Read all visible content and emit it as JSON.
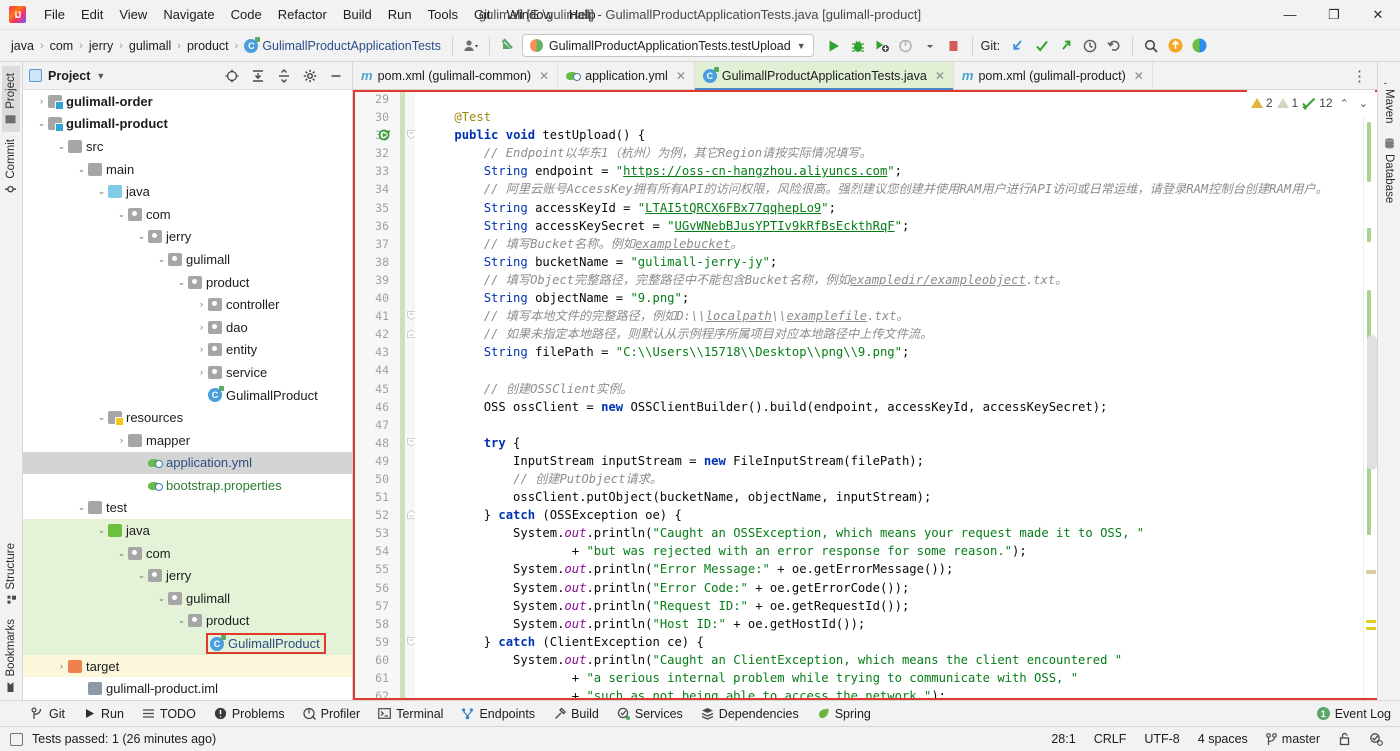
{
  "window": {
    "title": "gulimall [E:\\gulimall] - GulimallProductApplicationTests.java [gulimall-product]",
    "minimize": "—",
    "maximize": "❐",
    "close": "✕"
  },
  "menu": [
    "File",
    "Edit",
    "View",
    "Navigate",
    "Code",
    "Refactor",
    "Build",
    "Run",
    "Tools",
    "Git",
    "Window",
    "Help"
  ],
  "navbar": {
    "breadcrumbs": [
      "java",
      "com",
      "jerry",
      "gulimall",
      "product",
      "GulimallProductApplicationTests"
    ],
    "separator": "›",
    "run_config": "GulimallProductApplicationTests.testUpload",
    "dropdown_caret": "▼",
    "git_label": "Git:",
    "icons": [
      "profile-icon",
      "update-project-icon",
      "run-icon",
      "debug-icon",
      "run-coverage-icon",
      "profiler-icon",
      "stop-icon",
      "git-update-icon",
      "git-commit-icon",
      "git-push-icon",
      "history-icon",
      "rollback-icon",
      "search-everywhere-icon",
      "notifications-icon",
      "ai-assistant-icon"
    ]
  },
  "left_stripe": [
    {
      "label": "Project",
      "icon": "project-icon",
      "selected": true
    },
    {
      "label": "Commit",
      "icon": "commit-icon",
      "selected": false
    },
    {
      "label": "Structure",
      "icon": "structure-icon",
      "selected": false
    },
    {
      "label": "Bookmarks",
      "icon": "bookmarks-icon",
      "selected": false
    }
  ],
  "right_stripe": [
    {
      "label": "Maven",
      "icon": "maven-icon"
    },
    {
      "label": "Database",
      "icon": "database-icon"
    }
  ],
  "project_panel": {
    "title": "Project",
    "title_caret": "▼",
    "toolbar_icons": [
      "select-opened-file-icon",
      "expand-all-icon",
      "collapse-all-icon",
      "settings-gear-icon",
      "hide-icon"
    ],
    "tree": [
      {
        "label": "gulimall-order",
        "indent": 1,
        "arrow": "›",
        "icon": "module-folder-icon",
        "bold": true,
        "bg": "none"
      },
      {
        "label": "gulimall-product",
        "indent": 1,
        "arrow": "⌄",
        "icon": "module-folder-icon",
        "bold": true,
        "bg": "none"
      },
      {
        "label": "src",
        "indent": 2,
        "arrow": "⌄",
        "icon": "folder-icon",
        "bold": false,
        "bg": "none"
      },
      {
        "label": "main",
        "indent": 3,
        "arrow": "⌄",
        "icon": "folder-icon",
        "bold": false,
        "bg": "none"
      },
      {
        "label": "java",
        "indent": 4,
        "arrow": "⌄",
        "icon": "source-root-icon",
        "bold": false,
        "bg": "none"
      },
      {
        "label": "com",
        "indent": 5,
        "arrow": "⌄",
        "icon": "package-icon",
        "bold": false,
        "bg": "none"
      },
      {
        "label": "jerry",
        "indent": 6,
        "arrow": "⌄",
        "icon": "package-icon",
        "bold": false,
        "bg": "none"
      },
      {
        "label": "gulimall",
        "indent": 7,
        "arrow": "⌄",
        "icon": "package-icon",
        "bold": false,
        "bg": "none"
      },
      {
        "label": "product",
        "indent": 8,
        "arrow": "⌄",
        "icon": "package-icon",
        "bold": false,
        "bg": "none"
      },
      {
        "label": "controller",
        "indent": 9,
        "arrow": "›",
        "icon": "package-icon",
        "bold": false,
        "bg": "none"
      },
      {
        "label": "dao",
        "indent": 9,
        "arrow": "›",
        "icon": "package-icon",
        "bold": false,
        "bg": "none"
      },
      {
        "label": "entity",
        "indent": 9,
        "arrow": "›",
        "icon": "package-icon",
        "bold": false,
        "bg": "none"
      },
      {
        "label": "service",
        "indent": 9,
        "arrow": "›",
        "icon": "package-icon",
        "bold": false,
        "bg": "none"
      },
      {
        "label": "GulimallProduct",
        "indent": 9,
        "arrow": "",
        "icon": "java-class-icon",
        "bold": false,
        "bg": "none"
      },
      {
        "label": "resources",
        "indent": 4,
        "arrow": "⌄",
        "icon": "resources-folder-icon",
        "bold": false,
        "bg": "none"
      },
      {
        "label": "mapper",
        "indent": 5,
        "arrow": "›",
        "icon": "folder-icon",
        "bold": false,
        "bg": "none"
      },
      {
        "label": "application.yml",
        "indent": 6,
        "arrow": "",
        "icon": "yaml-file-icon",
        "bold": false,
        "bg": "selected",
        "color": "blue"
      },
      {
        "label": "bootstrap.properties",
        "indent": 6,
        "arrow": "",
        "icon": "yaml-file-icon",
        "bold": false,
        "bg": "none",
        "color": "green"
      },
      {
        "label": "test",
        "indent": 3,
        "arrow": "⌄",
        "icon": "folder-icon",
        "bold": false,
        "bg": "none"
      },
      {
        "label": "java",
        "indent": 4,
        "arrow": "⌄",
        "icon": "test-source-root-icon",
        "bold": false,
        "bg": "green"
      },
      {
        "label": "com",
        "indent": 5,
        "arrow": "⌄",
        "icon": "package-icon",
        "bold": false,
        "bg": "green"
      },
      {
        "label": "jerry",
        "indent": 6,
        "arrow": "⌄",
        "icon": "package-icon",
        "bold": false,
        "bg": "green"
      },
      {
        "label": "gulimall",
        "indent": 7,
        "arrow": "⌄",
        "icon": "package-icon",
        "bold": false,
        "bg": "green"
      },
      {
        "label": "product",
        "indent": 8,
        "arrow": "⌄",
        "icon": "package-icon",
        "bold": false,
        "bg": "green"
      },
      {
        "label": "GulimallProduct",
        "indent": 9,
        "arrow": "",
        "icon": "java-class-icon",
        "bold": false,
        "bg": "green",
        "color": "blue",
        "highlight": true
      },
      {
        "label": "target",
        "indent": 2,
        "arrow": "›",
        "icon": "excluded-folder-icon",
        "bold": false,
        "bg": "yellow"
      },
      {
        "label": "gulimall-product.iml",
        "indent": 3,
        "arrow": "",
        "icon": "iml-file-icon",
        "bold": false,
        "bg": "none"
      }
    ]
  },
  "editor": {
    "tabs": [
      {
        "label": "pom.xml (gulimall-common)",
        "icon": "maven-xml-icon",
        "active": false,
        "close": "✕"
      },
      {
        "label": "application.yml",
        "icon": "yaml-file-icon",
        "active": false,
        "close": "✕"
      },
      {
        "label": "GulimallProductApplicationTests.java",
        "icon": "java-class-icon",
        "active": true,
        "close": "✕"
      },
      {
        "label": "pom.xml (gulimall-product)",
        "icon": "maven-xml-icon",
        "active": false,
        "close": "✕"
      }
    ],
    "overflow_icon": "⋮",
    "first_line_number": 29,
    "last_line_number": 62,
    "inspection": {
      "warnings": "2",
      "weak_warnings": "1",
      "checks": "12",
      "up_caret": "⌃",
      "down_caret": "⌄"
    },
    "lines": [
      {
        "n": 29,
        "html": ""
      },
      {
        "n": 30,
        "html": "    <span class='ann'>@Test</span>"
      },
      {
        "n": 31,
        "html": "    <span class='kw'>public</span> <span class='kw'>void</span> testUpload() {",
        "run": true
      },
      {
        "n": 32,
        "html": "        <span class='cmt'>// Endpoint以华东1（杭州）为例，其它Region请按实际情况填写。</span>"
      },
      {
        "n": 33,
        "html": "        <span class='kw2'>String</span> endpoint = <span class='str'>\"</span><span class='lnk'>https://oss-cn-hangzhou.aliyuncs.com</span><span class='str'>\"</span>;"
      },
      {
        "n": 34,
        "html": "        <span class='cmt'>// 阿里云账号AccessKey拥有所有API的访问权限，风险很高。强烈建议您创建并使用RAM用户进行API访问或日常运维，请登录RAM控制台创建RAM用户。</span>"
      },
      {
        "n": 35,
        "html": "        <span class='kw2'>String</span> accessKeyId = <span class='str'>\"</span><span class='str ul'>LTAI5tQRCX6FBx77qqhepLo9</span><span class='str'>\"</span>;"
      },
      {
        "n": 36,
        "html": "        <span class='kw2'>String</span> accessKeySecret = <span class='str'>\"</span><span class='str ul'>UGvWNebBJusYPTIv9kRfBsEckthRqF</span><span class='str'>\"</span>;"
      },
      {
        "n": 37,
        "html": "        <span class='cmt'>// 填写Bucket名称。例如<span class='ul'>examplebucket</span>。</span>"
      },
      {
        "n": 38,
        "html": "        <span class='kw2'>String</span> bucketName = <span class='str'>\"gulimall-jerry-jy\"</span>;"
      },
      {
        "n": 39,
        "html": "        <span class='cmt'>// 填写Object完整路径，完整路径中不能包含Bucket名称，例如<span class='ul'>exampledir/exampleobject</span>.txt。</span>"
      },
      {
        "n": 40,
        "html": "        <span class='kw2'>String</span> objectName = <span class='str'>\"9.png\"</span>;"
      },
      {
        "n": 41,
        "html": "        <span class='cmt'>// 填写本地文件的完整路径，例如D:\\\\<span class='ul'>localpath</span>\\\\<span class='ul'>examplefile</span>.txt。</span>"
      },
      {
        "n": 42,
        "html": "        <span class='cmt'>// 如果未指定本地路径，则默认从示例程序所属项目对应本地路径中上传文件流。</span>"
      },
      {
        "n": 43,
        "html": "        <span class='kw2'>String</span> filePath = <span class='str'>\"C:\\\\Users\\\\15718\\\\Desktop\\\\png\\\\9.png\"</span>;"
      },
      {
        "n": 44,
        "html": ""
      },
      {
        "n": 45,
        "html": "        <span class='cmt'>// 创建OSSClient实例。</span>"
      },
      {
        "n": 46,
        "html": "        OSS ossClient = <span class='kw'>new</span> OSSClientBuilder().build(endpoint, accessKeyId, accessKeySecret);"
      },
      {
        "n": 47,
        "html": ""
      },
      {
        "n": 48,
        "html": "        <span class='kw'>try</span> {"
      },
      {
        "n": 49,
        "html": "            InputStream inputStream = <span class='kw'>new</span> FileInputStream(filePath);"
      },
      {
        "n": 50,
        "html": "            <span class='cmt'>// 创建PutObject请求。</span>"
      },
      {
        "n": 51,
        "html": "            ossClient.putObject(bucketName, objectName, inputStream);"
      },
      {
        "n": 52,
        "html": "        } <span class='kw'>catch</span> (OSSException oe) {"
      },
      {
        "n": 53,
        "html": "            System.<span class='fld'>out</span>.println(<span class='str'>\"Caught an OSSException, which means your request made it to OSS, \"</span>"
      },
      {
        "n": 54,
        "html": "                    + <span class='str'>\"but was rejected with an error response for some reason.\"</span>);"
      },
      {
        "n": 55,
        "html": "            System.<span class='fld'>out</span>.println(<span class='str'>\"Error Message:\"</span> + oe.getErrorMessage());"
      },
      {
        "n": 56,
        "html": "            System.<span class='fld'>out</span>.println(<span class='str'>\"Error Code:\"</span> + oe.getErrorCode());"
      },
      {
        "n": 57,
        "html": "            System.<span class='fld'>out</span>.println(<span class='str'>\"Request ID:\"</span> + oe.getRequestId());"
      },
      {
        "n": 58,
        "html": "            System.<span class='fld'>out</span>.println(<span class='str'>\"Host ID:\"</span> + oe.getHostId());"
      },
      {
        "n": 59,
        "html": "        } <span class='kw'>catch</span> (ClientException ce) {"
      },
      {
        "n": 60,
        "html": "            System.<span class='fld'>out</span>.println(<span class='str'>\"Caught an ClientException, which means the client encountered \"</span>"
      },
      {
        "n": 61,
        "html": "                    + <span class='str'>\"a serious internal problem while trying to communicate with OSS, \"</span>"
      },
      {
        "n": 62,
        "html": "                    + <span class='str'>\"such as not being able to access the network.\"</span>);"
      }
    ]
  },
  "bottom_tools": [
    {
      "label": "Git",
      "icon": "git-branch-icon"
    },
    {
      "label": "Run",
      "icon": "run-icon"
    },
    {
      "label": "TODO",
      "icon": "todo-icon"
    },
    {
      "label": "Problems",
      "icon": "problems-icon"
    },
    {
      "label": "Profiler",
      "icon": "profiler-icon"
    },
    {
      "label": "Terminal",
      "icon": "terminal-icon"
    },
    {
      "label": "Endpoints",
      "icon": "endpoints-icon"
    },
    {
      "label": "Build",
      "icon": "build-hammer-icon"
    },
    {
      "label": "Services",
      "icon": "services-icon"
    },
    {
      "label": "Dependencies",
      "icon": "dependencies-icon"
    },
    {
      "label": "Spring",
      "icon": "spring-leaf-icon"
    }
  ],
  "event_log": {
    "count": "1",
    "label": "Event Log"
  },
  "status_bar": {
    "message": "Tests passed: 1 (26 minutes ago)",
    "caret": "28:1",
    "line_sep": "CRLF",
    "encoding": "UTF-8",
    "indent": "4 spaces",
    "branch": "master",
    "lock_icon": "read-only-toggle-icon",
    "inspection_icon": "inspection-level-icon"
  },
  "colors": {
    "accent_blue": "#4a88c7",
    "test_green": "#e4f2d8",
    "highlight_red": "#e03a2f",
    "string_green": "#067d17",
    "keyword_blue": "#0033b3",
    "comment_gray": "#8c8c8c"
  }
}
